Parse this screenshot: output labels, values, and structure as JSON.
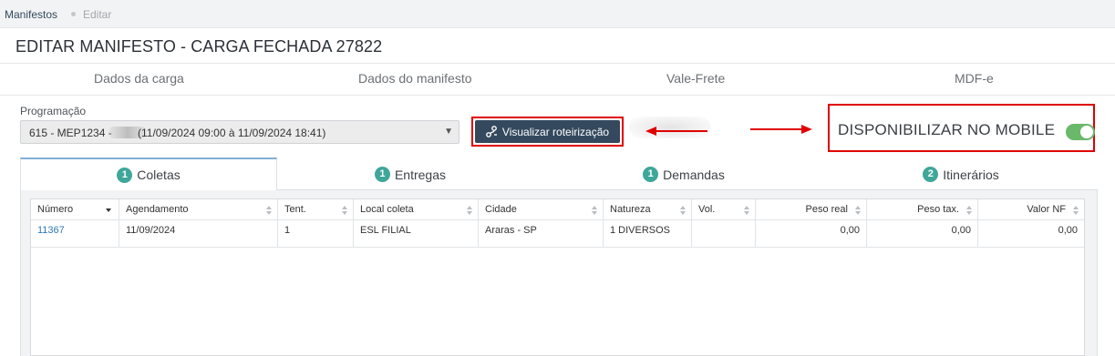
{
  "breadcrumb": {
    "parent": "Manifestos",
    "current": "Editar"
  },
  "page": {
    "title": "EDITAR MANIFESTO - CARGA FECHADA 27822"
  },
  "top_tabs": [
    "Dados da carga",
    "Dados do manifesto",
    "Vale-Frete",
    "MDF-e"
  ],
  "programacao": {
    "label": "Programação",
    "code": "615 - MEP1234 -",
    "period": "(11/09/2024 09:00 à 11/09/2024 18:41)"
  },
  "route_button": {
    "label": "Visualizar roteirização",
    "icon": "route-icon"
  },
  "mobile": {
    "label": "DISPONIBILIZAR NO MOBILE",
    "enabled": true,
    "color": "#6bb86b"
  },
  "sub_tabs": [
    {
      "count": "1",
      "label": "Coletas",
      "active": true
    },
    {
      "count": "1",
      "label": "Entregas",
      "active": false
    },
    {
      "count": "1",
      "label": "Demandas",
      "active": false
    },
    {
      "count": "2",
      "label": "Itinerários",
      "active": false
    }
  ],
  "grid": {
    "columns": [
      "Número",
      "Agendamento",
      "Tent.",
      "Local coleta",
      "Cidade",
      "Natureza",
      "Vol.",
      "Peso real",
      "Peso tax.",
      "Valor NF"
    ],
    "rows": [
      [
        "11367",
        "11/09/2024",
        "1",
        "ESL FILIAL",
        "Araras - SP",
        "1 DIVERSOS",
        "",
        "0,00",
        "0,00",
        "0,00"
      ]
    ]
  },
  "colors": {
    "accent": "#34495e",
    "badge": "#3fa69a",
    "highlight": "#e00000",
    "link": "#2f79b5"
  }
}
